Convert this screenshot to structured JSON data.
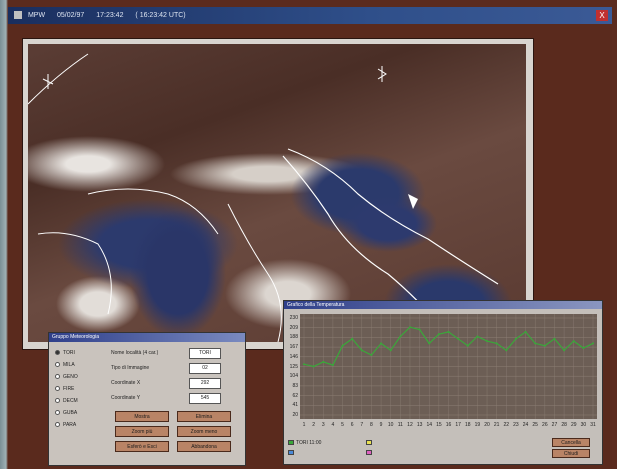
{
  "window": {
    "title_parts": [
      "MPW",
      "05/02/97",
      "17:23:42",
      "( 16:23:42 UTC)"
    ],
    "close_label": "X"
  },
  "image_panel": {
    "title": "Gruppo Meteorologia",
    "stations": [
      {
        "label": "TORI",
        "selected": true
      },
      {
        "label": "MILA",
        "selected": false
      },
      {
        "label": "GENO",
        "selected": false
      },
      {
        "label": "FIRE",
        "selected": false
      },
      {
        "label": "DECM",
        "selected": false
      },
      {
        "label": "GUBA",
        "selected": false
      },
      {
        "label": "PARA",
        "selected": false
      }
    ],
    "fields": [
      {
        "label": "Nome località (4 car.)",
        "value": "TORI"
      },
      {
        "label": "Tipo di Immagine",
        "value": "02"
      },
      {
        "label": "Coordinate X",
        "value": "292"
      },
      {
        "label": "Coordinate Y",
        "value": "545"
      }
    ],
    "buttons": [
      "Mostra",
      "Elimina",
      "Zoom più",
      "Zoom meno",
      "Esferò e Esci",
      "Abbandona"
    ]
  },
  "graph_panel": {
    "title": "Grafico della Temperatura",
    "legend": [
      {
        "label": "TORI 11:00",
        "color": "#3aa83a",
        "checked": true
      },
      {
        "label": "",
        "color": "#e8e050",
        "checked": false
      },
      {
        "label": "",
        "color": "#4a8ad8",
        "checked": false
      },
      {
        "label": "",
        "color": "#e060c0",
        "checked": false
      }
    ],
    "buttons": [
      "Cancella",
      "Chiudi"
    ]
  },
  "chart_data": {
    "type": "line",
    "x": [
      1,
      2,
      3,
      4,
      5,
      6,
      7,
      8,
      9,
      10,
      11,
      12,
      13,
      14,
      15,
      16,
      17,
      18,
      19,
      20,
      21,
      22,
      23,
      24,
      25,
      26,
      27,
      28,
      29,
      30,
      31
    ],
    "x_tick_labels": [
      "1",
      "2",
      "3",
      "4",
      "5",
      "6",
      "7",
      "8",
      "9",
      "10",
      "11",
      "12",
      "13",
      "14",
      "15",
      "16",
      "17",
      "18",
      "19",
      "20",
      "21",
      "22",
      "23",
      "24",
      "25",
      "26",
      "27",
      "28",
      "29",
      "30",
      "31"
    ],
    "y_tick_labels": [
      "230",
      "209",
      "188",
      "167",
      "146",
      "125",
      "104",
      "83",
      "62",
      "41",
      "20"
    ],
    "ylim": [
      20,
      230
    ],
    "series": [
      {
        "name": "TORI 11:00",
        "color": "#3aa83a",
        "values": [
          130,
          125,
          135,
          128,
          170,
          185,
          160,
          150,
          175,
          160,
          190,
          210,
          205,
          175,
          195,
          200,
          185,
          170,
          190,
          180,
          175,
          160,
          185,
          200,
          175,
          170,
          185,
          160,
          180,
          165,
          175
        ]
      }
    ],
    "grid": true
  }
}
